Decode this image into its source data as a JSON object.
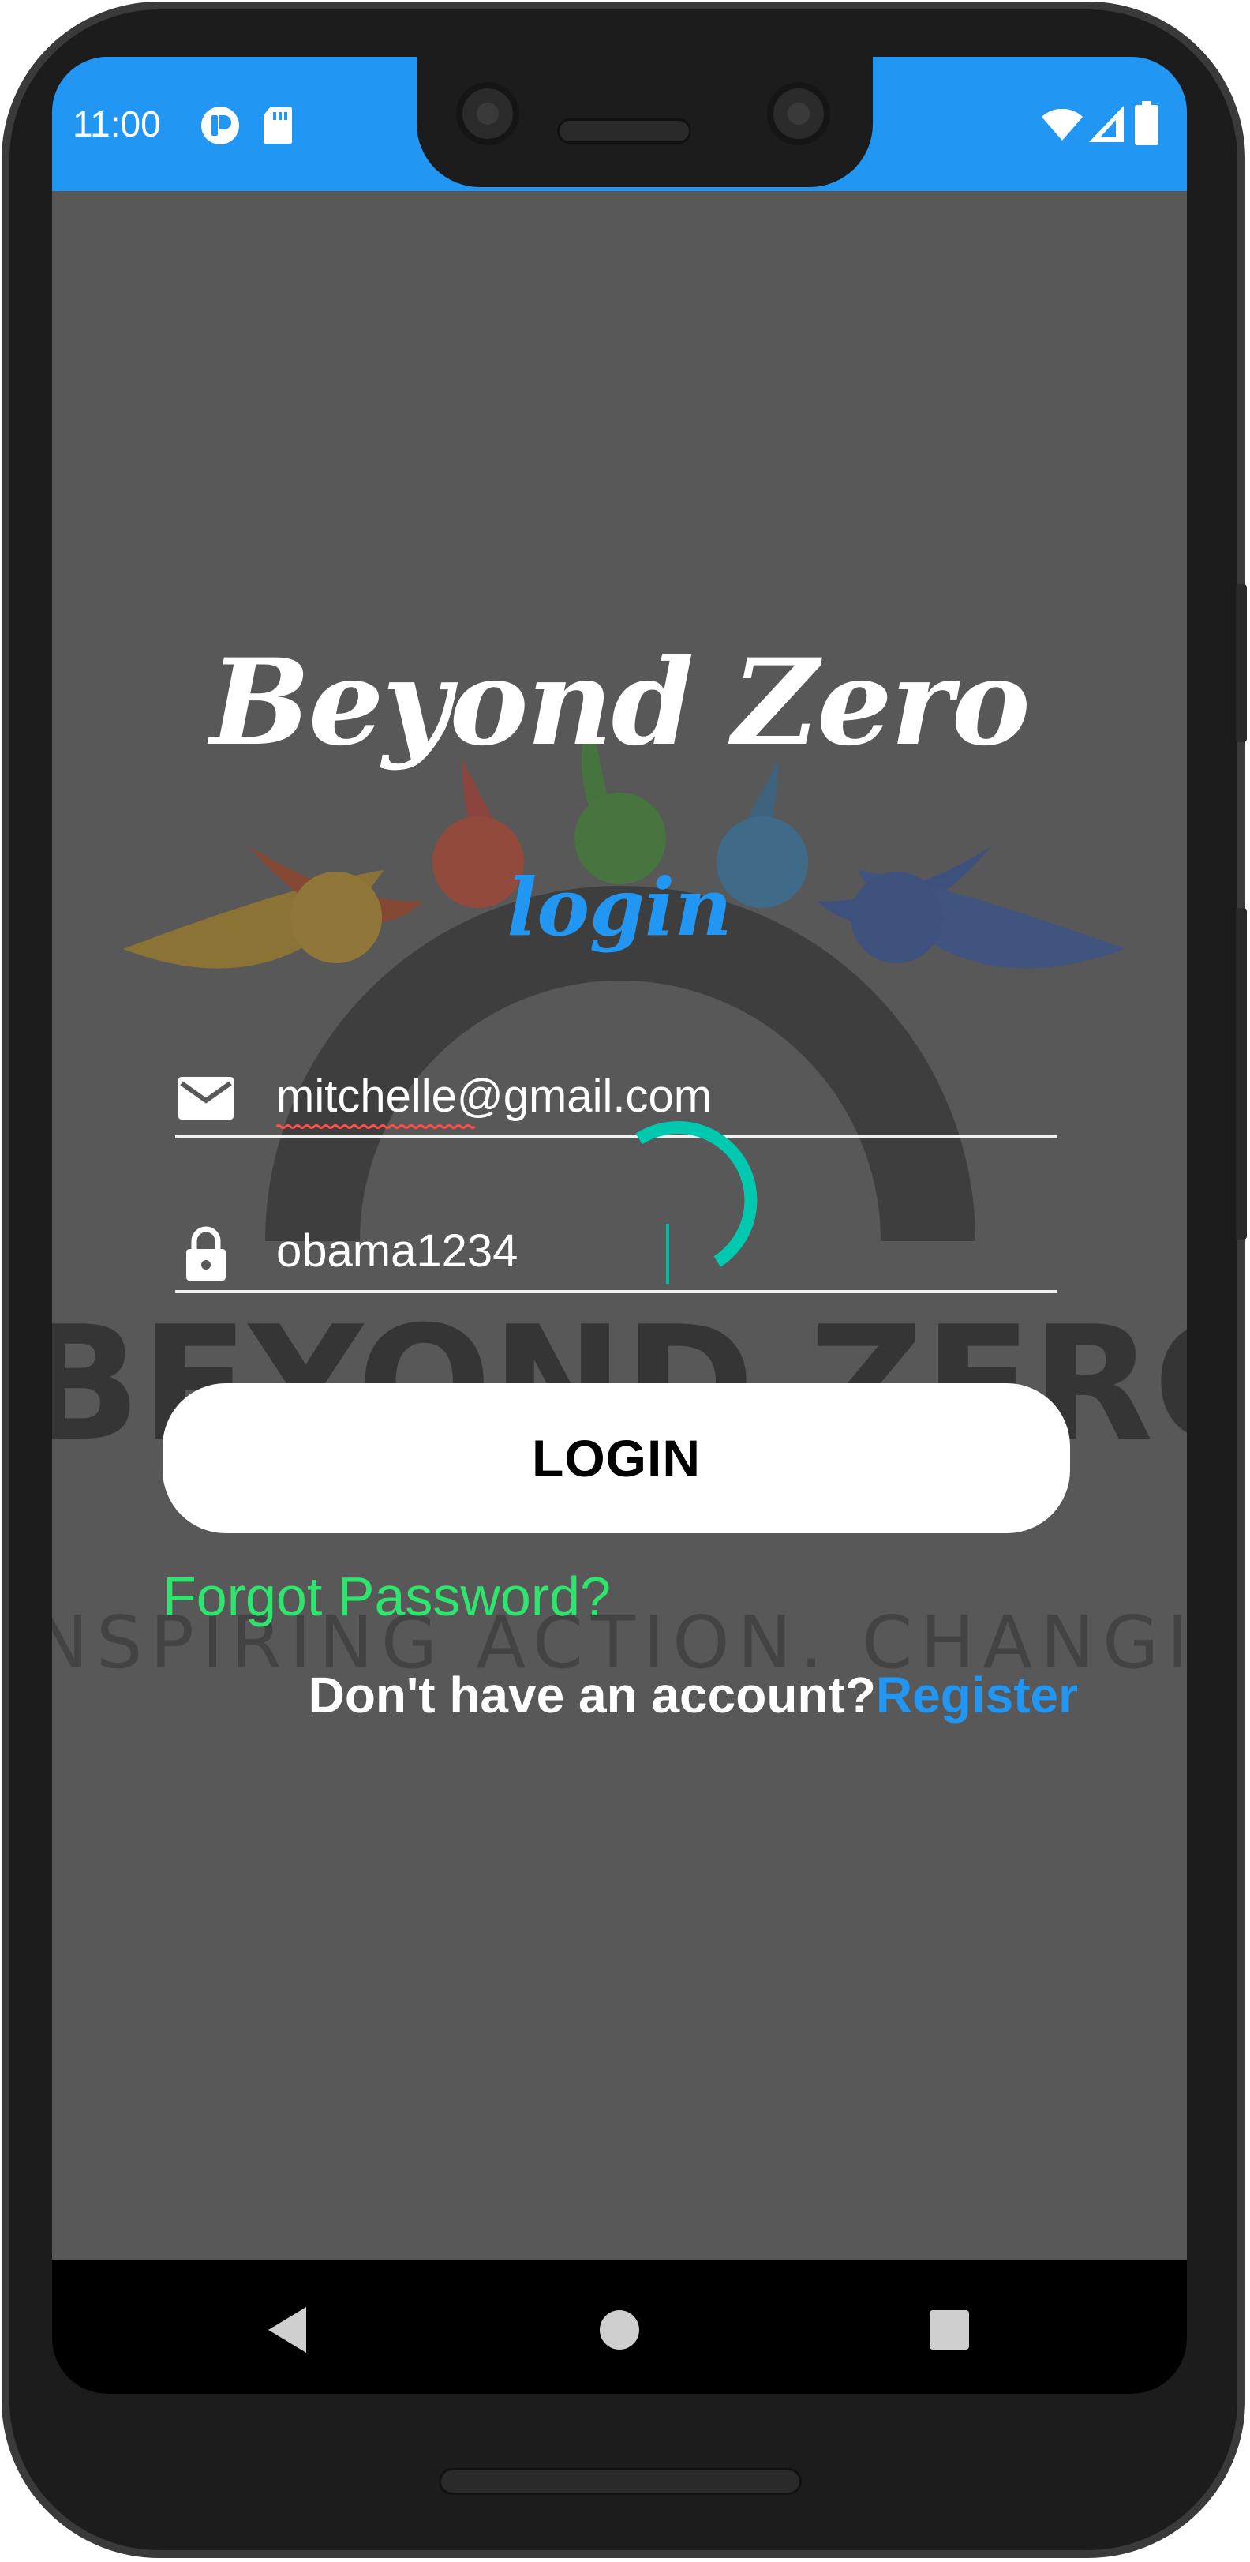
{
  "status_bar": {
    "time": "11:00",
    "icons": [
      "app-notification-icon",
      "sd-card-icon",
      "wifi-icon",
      "cellular-signal-icon",
      "battery-icon"
    ]
  },
  "app": {
    "title": "Beyond Zero",
    "heading": "login",
    "background_logo_text": "BEYOND ZERO",
    "background_logo_tagline": "INSPIRING ACTION. CHANGING LIVES"
  },
  "form": {
    "email": {
      "icon": "email-icon",
      "value": "mitchelle@gmail.com"
    },
    "password": {
      "icon": "lock-icon",
      "value": "obama1234"
    },
    "login_button_label": "LOGIN",
    "forgot_password_label": "Forgot Password?",
    "no_account_text": "Don't have an account?",
    "register_label": "Register"
  },
  "loading": {
    "spinner_visible": true
  },
  "nav_bar": {
    "buttons": [
      "back-icon",
      "home-icon",
      "recents-icon"
    ]
  },
  "colors": {
    "status_bar": "#2196f3",
    "accent_blue": "#2196f3",
    "forgot_green": "#2ee66e",
    "spinner": "#00c9b0",
    "screen_bg": "#585858"
  }
}
